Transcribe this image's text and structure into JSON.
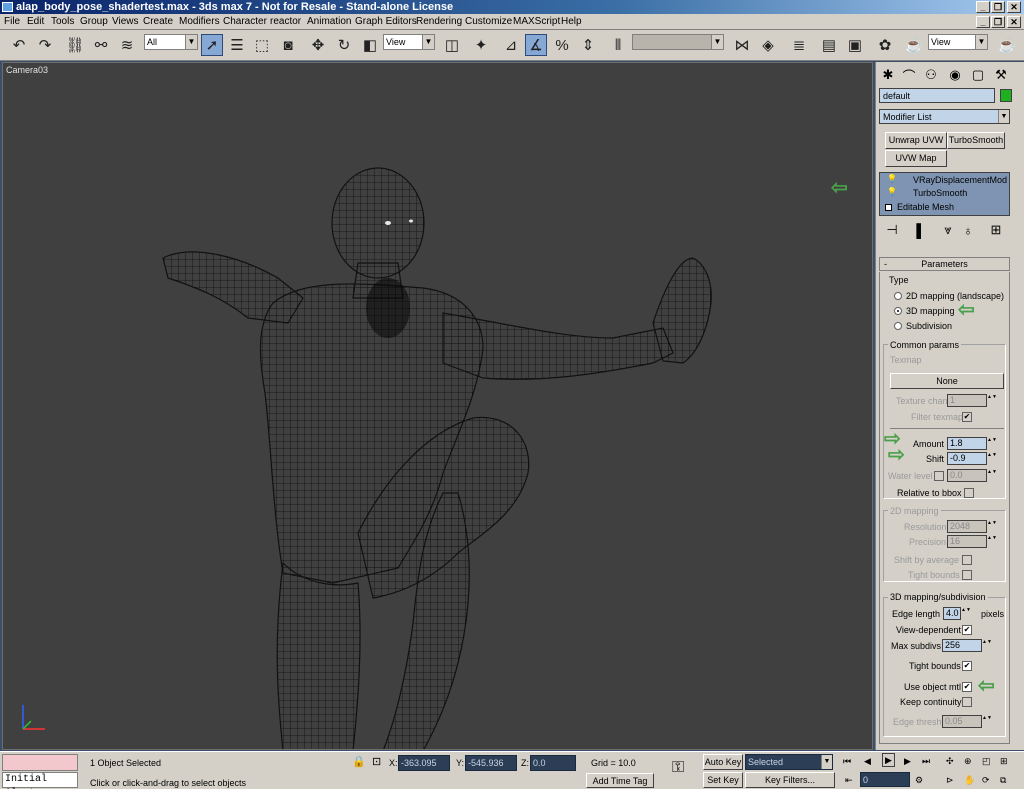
{
  "window": {
    "title": "alap_body_pose_shadertest.max - 3ds max 7 - Not for Resale - Stand-alone License",
    "buttons": [
      "_",
      "❐",
      "✕"
    ]
  },
  "menu": [
    "File",
    "Edit",
    "Tools",
    "Group",
    "Views",
    "Create",
    "Modifiers",
    "Character",
    "reactor",
    "Animation",
    "Graph Editors",
    "Rendering",
    "Customize",
    "MAXScript",
    "Help"
  ],
  "toolbar": {
    "selection_filter": "All",
    "ref_coord": "View",
    "named_selection": "",
    "view_dropdown": "View"
  },
  "viewport": {
    "label": "Camera03"
  },
  "panel": {
    "object_name": "default",
    "object_color": "#1fb01f",
    "modifier_list": "Modifier List",
    "quick_buttons": [
      "Unwrap UVW",
      "TurboSmooth",
      "UVW Map"
    ],
    "stack": [
      "VRayDisplacementMod",
      "TurboSmooth",
      "Editable Mesh"
    ],
    "rollout_title": "Parameters",
    "rollout_sign": "-",
    "type": {
      "title": "Type",
      "options": [
        "2D mapping (landscape)",
        "3D mapping",
        "Subdivision"
      ],
      "selected": "3D mapping"
    },
    "common": {
      "title": "Common params",
      "texmap_label": "Texmap",
      "texmap_value": "None",
      "texture_chan_label": "Texture chan",
      "texture_chan_value": "1",
      "filter_texmap_label": "Filter texmap",
      "amount_label": "Amount",
      "amount_value": "1.8",
      "shift_label": "Shift",
      "shift_value": "-0.9",
      "water_level_label": "Water level",
      "water_level_value": "0.0",
      "relative_bbox_label": "Relative to bbox"
    },
    "mapping2d": {
      "title": "2D mapping",
      "resolution_label": "Resolution",
      "resolution_value": "2048",
      "precision_label": "Precision",
      "precision_value": "16",
      "tight_bounds_label": "Tight bounds",
      "shift_by_avg_label": "Shift by average"
    },
    "mapping3d": {
      "title": "3D mapping/subdivision",
      "edge_length_label": "Edge length",
      "edge_length_value": "4.0",
      "edge_length_unit": "pixels",
      "view_dependent_label": "View-dependent",
      "max_subdivs_label": "Max subdivs",
      "max_subdivs_value": "256",
      "tight_bounds_label": "Tight bounds",
      "use_object_mtl_label": "Use object mtl",
      "keep_continuity_label": "Keep continuity",
      "edge_thresh_label": "Edge thresh",
      "edge_thresh_value": "0.05"
    }
  },
  "status": {
    "maxscript_output": "Initial Clust",
    "selection": "1 Object Selected",
    "prompt": "Click or click-and-drag to select objects",
    "x_label": "X:",
    "x_value": "-363.095",
    "y_label": "Y:",
    "y_value": "-545.936",
    "z_label": "Z:",
    "z_value": "0.0",
    "grid": "Grid = 10.0",
    "add_time_tag": "Add Time Tag",
    "auto_key": "Auto Key",
    "auto_key_mode": "Selected",
    "set_key": "Set Key",
    "key_filters": "Key Filters...",
    "frame": "0"
  }
}
